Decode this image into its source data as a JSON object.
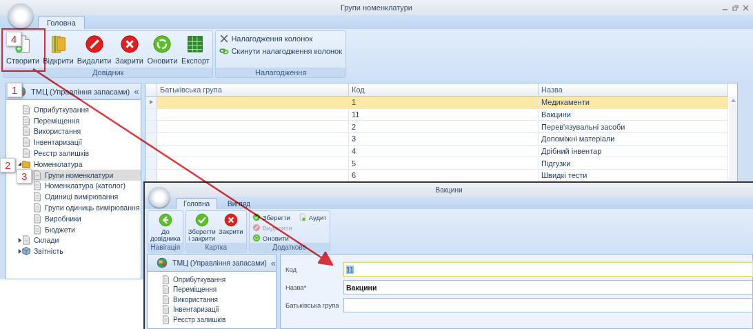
{
  "window": {
    "title": "Групи номенклатури",
    "ribbon": {
      "tabs": [
        {
          "label": "Головна",
          "selected": true
        }
      ],
      "groups": [
        {
          "label": "Довідник",
          "kind": "large",
          "buttons": [
            {
              "label": "Створити",
              "kind": "create"
            },
            {
              "label": "Відкрити",
              "kind": "open"
            },
            {
              "label": "Видалити",
              "kind": "delete"
            },
            {
              "label": "Закрити",
              "kind": "close"
            },
            {
              "label": "Оновити",
              "kind": "refresh"
            },
            {
              "label": "Експорт",
              "kind": "export"
            }
          ]
        },
        {
          "label": "Налагодження",
          "kind": "small",
          "buttons": [
            {
              "label": "Налагодження колонок",
              "kind": "columns"
            },
            {
              "label": "Скинути налагодження колонок",
              "kind": "reset"
            }
          ]
        }
      ]
    },
    "navigator": {
      "title": "ТМЦ (Управління запасами)",
      "collapse": "«",
      "items": [
        {
          "label": "Оприбуткування",
          "kind": "page",
          "selected": false
        },
        {
          "label": "Переміщення",
          "kind": "page",
          "selected": false
        },
        {
          "label": "Використання",
          "kind": "page",
          "selected": false
        },
        {
          "label": "Інвентаризації",
          "kind": "page",
          "selected": false
        },
        {
          "label": "Реєстр залишків",
          "kind": "page",
          "selected": false
        },
        {
          "label": "Номенклатура",
          "kind": "folder",
          "selected": false,
          "expanded": true,
          "children": [
            {
              "label": "Групи номенклатури",
              "kind": "page",
              "selected": true
            },
            {
              "label": "Номенклатура (католог)",
              "kind": "page",
              "selected": false
            },
            {
              "label": "Одиниці вимірювання",
              "kind": "page",
              "selected": false
            },
            {
              "label": "Групи одиниць вимірювання",
              "kind": "page",
              "selected": false
            },
            {
              "label": "Виробники",
              "kind": "page",
              "selected": false
            },
            {
              "label": "Бюджети",
              "kind": "page",
              "selected": false
            }
          ]
        },
        {
          "label": "Склади",
          "kind": "page",
          "selected": false,
          "expanded": false
        },
        {
          "label": "Звітність",
          "kind": "cube",
          "selected": false,
          "expanded": false
        }
      ]
    },
    "grid": {
      "columns": [
        "Батьківська група",
        "Код",
        "Назва"
      ],
      "rows": [
        {
          "code": "1",
          "name": "Медикаменти",
          "selected": true
        },
        {
          "code": "11",
          "name": "Вакцини",
          "selected": false
        },
        {
          "code": "2",
          "name": "Перев'язувальні засоби",
          "selected": false
        },
        {
          "code": "3",
          "name": "Допоміжні матеріали",
          "selected": false
        },
        {
          "code": "4",
          "name": "Дрібний інвентар",
          "selected": false
        },
        {
          "code": "5",
          "name": "Підгузки",
          "selected": false
        },
        {
          "code": "6",
          "name": "Швидкі тести",
          "selected": false
        }
      ]
    }
  },
  "card_window": {
    "title": "Вакцини",
    "ribbon": {
      "tabs": [
        {
          "label": "Головна",
          "selected": true
        },
        {
          "label": "Вигляд",
          "selected": false
        }
      ],
      "groups": [
        {
          "label": "Навігація",
          "kind": "large",
          "buttons": [
            {
              "label": "До довідника",
              "kind": "back"
            }
          ]
        },
        {
          "label": "Картка",
          "kind": "large",
          "buttons": [
            {
              "label": "Зберегти і закрити",
              "kind": "save"
            },
            {
              "label": "Закрити",
              "kind": "close"
            }
          ]
        },
        {
          "label": "Додатково",
          "kind": "small",
          "buttons": [
            {
              "label": "Зберегти",
              "kind": "save",
              "disabled": false
            },
            {
              "label": "Видалити",
              "kind": "delete",
              "disabled": true
            },
            {
              "label": "Оновити",
              "kind": "refresh",
              "disabled": false
            },
            {
              "label": "Аудит",
              "kind": "audit",
              "disabled": false
            }
          ]
        }
      ]
    },
    "navigator": {
      "title": "ТМЦ (Управління запасами)",
      "collapse": "«",
      "items": [
        {
          "label": "Оприбуткування",
          "kind": "page",
          "selected": false
        },
        {
          "label": "Переміщення",
          "kind": "page",
          "selected": false
        },
        {
          "label": "Використання",
          "kind": "page",
          "selected": false
        },
        {
          "label": "Інвентаризації",
          "kind": "page",
          "selected": false
        },
        {
          "label": "Реєстр залишків",
          "kind": "page",
          "selected": false
        }
      ]
    },
    "form": {
      "fields": [
        {
          "label": "Код",
          "value": "11",
          "focused": true,
          "bold": false
        },
        {
          "label": "Назва*",
          "value": "Вакцини",
          "focused": false,
          "bold": true
        },
        {
          "label": "Батьківська група",
          "focused": false
        }
      ]
    }
  },
  "callouts": [
    {
      "number": "4"
    },
    {
      "number": "1"
    },
    {
      "number": "2"
    },
    {
      "number": "3"
    }
  ]
}
